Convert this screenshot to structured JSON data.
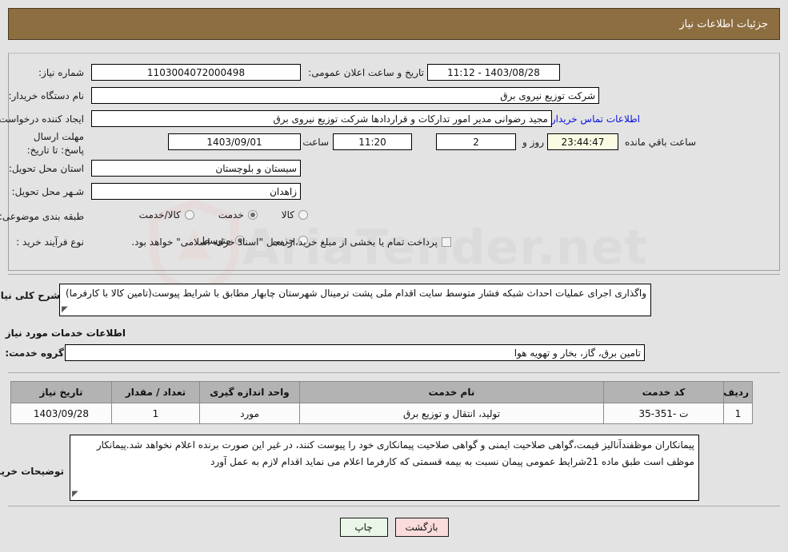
{
  "header": {
    "title": "جزئیات اطلاعات نیاز"
  },
  "watermark": {
    "text": "AriaTender.net"
  },
  "form": {
    "need_number_label": "شماره نیاز:",
    "need_number_value": "1103004072000498",
    "announce_label": "تاریخ و ساعت اعلان عمومی:",
    "announce_value": "1403/08/28 - 11:12",
    "buyer_org_label": "نام دستگاه خریدار:",
    "buyer_org_value": "شرکت توزیع نیروی برق",
    "creator_label": "ایجاد کننده درخواست:",
    "creator_value": "مجید  رضوانی مدیر امور تدارکات و قراردادها شرکت توزیع نیروی برق",
    "contact_link": "اطلاعات تماس خریدار",
    "deadline_label": "مهلت ارسال پاسخ: تا تاریخ:",
    "deadline_date": "1403/09/01",
    "deadline_hour_label": "ساعت",
    "deadline_hour_value": "11:20",
    "days_value": "2",
    "days_label": "روز و",
    "countdown_value": "23:44:47",
    "countdown_label": "ساعت باقي مانده",
    "province_label": "استان محل تحویل:",
    "province_value": "سیستان و بلوچستان",
    "city_label": "شـهر محل تحویل:",
    "city_value": "زاهدان",
    "category_label": "طبقه بندی موضوعی:",
    "category_options": [
      {
        "label": "کالا",
        "checked": false
      },
      {
        "label": "خدمت",
        "checked": true
      },
      {
        "label": "کالا/خدمت",
        "checked": false
      }
    ],
    "process_label": "نوع فرآیند خرید :",
    "process_options": [
      {
        "label": "جزیي",
        "checked": false
      },
      {
        "label": "متوسط",
        "checked": true
      }
    ],
    "treasury_checkbox_label": "پرداخت تمام یا بخشی از مبلغ خرید،از محل \"اسناد خزانه اسلامی\" خواهد بود.",
    "treasury_checked": false,
    "summary_label": "شرح کلی نیاز:",
    "summary_value": "واگذاری اجرای عملیات احداث شبکه فشار متوسط سایت اقدام ملی پشت ترمینال شهرستان چابهار مطابق با شرایط پیوست(تامین کالا با کارفرما)",
    "services_section_title": "اطلاعات خدمات مورد نیاز",
    "service_group_label": "گروه خدمت:",
    "service_group_value": "تامین برق، گاز، بخار و تهویه هوا",
    "buyer_notes_label": "توضیحات خریدار:",
    "buyer_notes_value": "پیمانکاران موظفندآنالیز قیمت،گواهی صلاحیت ایمنی و گواهی صلاحیت پیمانکاری خود را پیوست کنند، در غیر این صورت برنده اعلام نخواهد شد.پیمانکار موظف است طبق ماده 21شرایط عمومی پیمان نسبت به بیمه قسمتی که کارفرما اعلام می نماید اقدام لازم به عمل آورد"
  },
  "table": {
    "headers": [
      "ردیف",
      "کد خدمت",
      "نام خدمت",
      "واحد اندازه گیری",
      "تعداد / مقدار",
      "تاریخ نیاز"
    ],
    "rows": [
      {
        "index": "1",
        "code": "ت -351-35",
        "name": "تولید، انتقال و توزیع برق",
        "unit": "مورد",
        "quantity": "1",
        "date": "1403/09/28"
      }
    ]
  },
  "footer": {
    "print_label": "چاپ",
    "back_label": "بازگشت"
  },
  "colors": {
    "header_bar": "#8d6e41",
    "page_bg": "#e3e3e3",
    "link": "#0b11e0",
    "table_header": "#b3b3b3",
    "print_btn": "#eaf6e8",
    "back_btn": "#fbdcdc",
    "countdown_bg": "#fbfbe4"
  }
}
